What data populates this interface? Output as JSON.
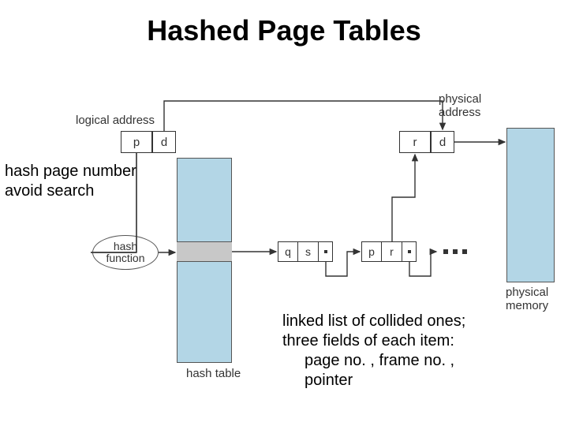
{
  "title": "Hashed Page Tables",
  "labels": {
    "logical_address": "logical address",
    "physical_address": "physical\naddress",
    "hash_function": "hash\nfunction",
    "hash_table": "hash table",
    "physical_memory": "physical\nmemory"
  },
  "logical": {
    "p": "p",
    "d": "d"
  },
  "physical": {
    "r": "r",
    "d": "d"
  },
  "node1": {
    "q": "q",
    "s": "s"
  },
  "node2": {
    "p": "p",
    "r": "r"
  },
  "annotations": {
    "left_line1": "hash page number",
    "left_line2": "avoid search",
    "right_line1": "linked list of collided ones;",
    "right_line2": "three fields of each item:",
    "right_line3": "page no. , frame no. ,",
    "right_line4": "pointer"
  }
}
